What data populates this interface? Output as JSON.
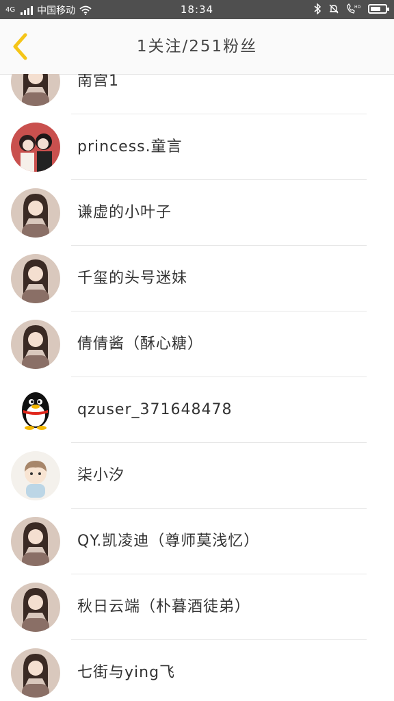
{
  "status_bar": {
    "signal_label": "4G",
    "carrier": "中国移动",
    "time": "18:34"
  },
  "header": {
    "title": "1关注/251粉丝"
  },
  "colors": {
    "accent": "#f5c518",
    "status_bar_bg": "#4f4f4f"
  },
  "followers": [
    {
      "name": "南宫1",
      "avatar": "girl-portrait-avatar"
    },
    {
      "name": "princess.童言",
      "avatar": "anime-couple-avatar"
    },
    {
      "name": "谦虚的小叶子",
      "avatar": "girl-portrait-avatar"
    },
    {
      "name": "千玺的头号迷妹",
      "avatar": "girl-portrait-avatar"
    },
    {
      "name": "倩倩酱（酥心糖）",
      "avatar": "girl-portrait-avatar"
    },
    {
      "name": "qzuser_371648478",
      "avatar": "qq-penguin-avatar"
    },
    {
      "name": "柒小汐",
      "avatar": "cartoon-boy-avatar"
    },
    {
      "name": "QY.凯凌迪（尊师莫浅忆）",
      "avatar": "girl-portrait-avatar"
    },
    {
      "name": "秋日云端（朴暮酒徒弟）",
      "avatar": "girl-portrait-avatar"
    },
    {
      "name": "七街与ying飞",
      "avatar": "girl-portrait-avatar"
    }
  ]
}
